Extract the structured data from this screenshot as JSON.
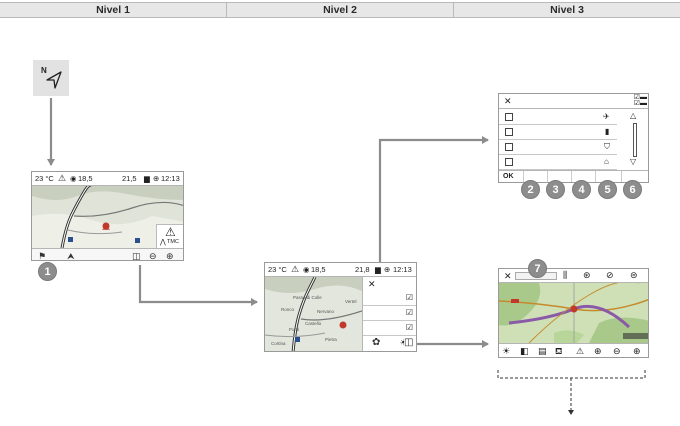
{
  "header": {
    "col1": "Nivel 1",
    "col2": "Nivel 2",
    "col3": "Nivel 3"
  },
  "nav_icon": {
    "letter": "N"
  },
  "screen1": {
    "temp": "23 °C",
    "warn_glyph": "⚠",
    "speed": "18,5",
    "dist": "21,5",
    "time": "12:13",
    "tmc_label": "TMC",
    "badge": "1"
  },
  "screen2": {
    "temp": "23 °C",
    "warn_glyph": "⚠",
    "speed": "18,5",
    "dist": "21,8",
    "time": "12:13",
    "close": "✕",
    "map_labels": [
      "Passo di Colle",
      "Vertel",
      "Ronco",
      "Nervano",
      "Castello",
      "Ponti",
      "Pietra",
      "Cortina"
    ]
  },
  "screen3": {
    "close": "✕",
    "ok": "OK",
    "badges": [
      "2",
      "3",
      "4",
      "5",
      "6"
    ]
  },
  "screen4": {
    "close": "✕",
    "badge": "7"
  },
  "colors": {
    "arrow": "#8c8c8c",
    "badge": "#8d8d8d",
    "header_bg": "#e7e7e7"
  }
}
